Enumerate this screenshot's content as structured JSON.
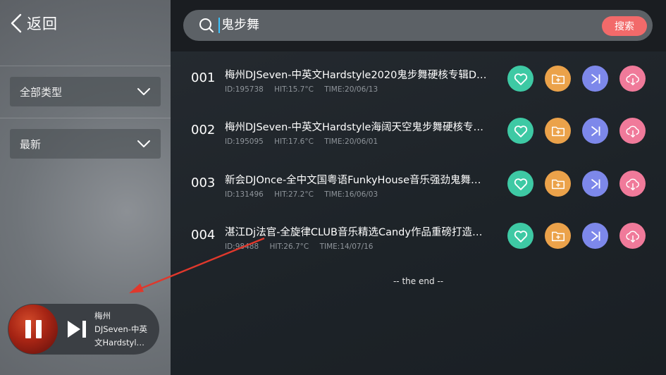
{
  "sidebar": {
    "back_label": "返回",
    "filters": [
      {
        "label": "全部类型"
      },
      {
        "label": "最新"
      }
    ]
  },
  "player": {
    "track_line1": "梅州",
    "track_line2": "DJSeven-中英",
    "track_line3": "文Hardstyle…"
  },
  "search": {
    "query": "鬼步舞",
    "button_label": "搜索"
  },
  "results": [
    {
      "num": "001",
      "title": "梅州DJSeven-中英文Hardstyle2020鬼步舞硬核专辑DJ…",
      "id": "ID:195738",
      "hit": "HIT:15.7°C",
      "time": "TIME:20/06/13"
    },
    {
      "num": "002",
      "title": "梅州DJSeven-中英文Hardstyle海阔天空鬼步舞硬核专辑…",
      "id": "ID:195095",
      "hit": "HIT:17.6°C",
      "time": "TIME:20/06/01"
    },
    {
      "num": "003",
      "title": "新会DJOnce-全中文国粤语FunkyHouse音乐强劲鬼舞步…",
      "id": "ID:131496",
      "hit": "HIT:27.2°C",
      "time": "TIME:16/06/03"
    },
    {
      "num": "004",
      "title": "湛江Dj法官-全旋律CLUB音乐精选Candy作品重磅打造最…",
      "id": "ID:98488",
      "hit": "HIT:26.7°C",
      "time": "TIME:14/07/16"
    }
  ],
  "end_text": "-- the end --",
  "colors": {
    "heart": "#3ec9a4",
    "folder": "#eba24a",
    "next": "#7d88ea",
    "download": "#f07a9a",
    "search_button": "#f26a6a",
    "annotation_arrow": "#e0382c"
  }
}
